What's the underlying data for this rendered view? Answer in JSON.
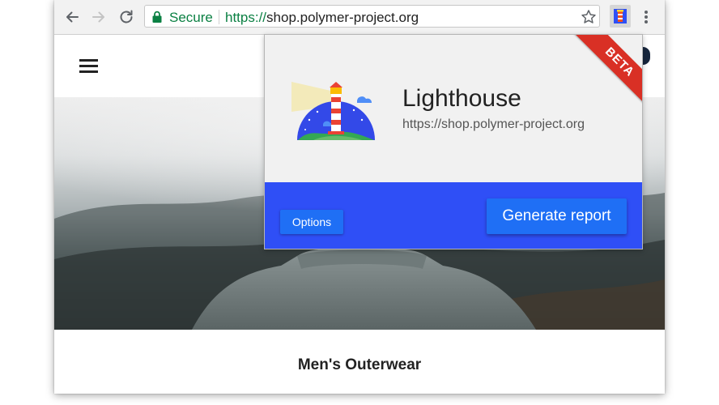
{
  "browser": {
    "security_label": "Secure",
    "url_scheme": "https://",
    "url_host": "shop.polymer-project.org",
    "icons": [
      "back-arrow-icon",
      "forward-arrow-icon",
      "reload-icon",
      "lock-icon",
      "bookmark-star-icon",
      "lighthouse-extension-icon",
      "more-vert-icon"
    ]
  },
  "page": {
    "menu_icon": "hamburger-menu-icon",
    "category_title": "Men's Outerwear"
  },
  "popup": {
    "title": "Lighthouse",
    "url": "https://shop.polymer-project.org",
    "badge": "BETA",
    "options_label": "Options",
    "generate_label": "Generate report",
    "colors": {
      "footer": "#2f4ff6",
      "button": "#1f6ff5",
      "badge": "#d93025",
      "secure": "#0b8043"
    }
  }
}
